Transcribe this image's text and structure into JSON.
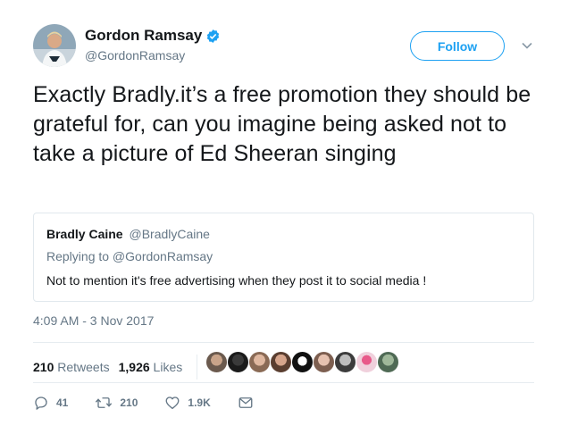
{
  "user": {
    "display_name": "Gordon Ramsay",
    "handle": "@GordonRamsay",
    "verified": true
  },
  "follow_label": "Follow",
  "tweet_text": "Exactly Bradly.it’s a free promotion they should be grateful for, can you imagine being asked not to take a picture of Ed Sheeran singing",
  "quoted_tweet": {
    "name": "Bradly Caine",
    "handle": "@BradlyCaine",
    "replying_to": "Replying to @GordonRamsay",
    "text": "Not to mention it's free advertising when they post it to social media !"
  },
  "timestamp": "4:09 AM - 3 Nov 2017",
  "stats": {
    "retweets_count": "210",
    "retweets_label": "Retweets",
    "likes_count": "1,926",
    "likes_label": "Likes"
  },
  "facepile_count": 9,
  "actions": {
    "replies": "41",
    "retweets": "210",
    "likes": "1.9K"
  },
  "colors": {
    "brand_blue": "#1da1f2",
    "secondary_text": "#657786",
    "border": "#e1e8ed"
  },
  "icons": [
    "verified-badge-icon",
    "chevron-down-icon",
    "reply-icon",
    "retweet-icon",
    "like-icon",
    "direct-message-icon"
  ]
}
